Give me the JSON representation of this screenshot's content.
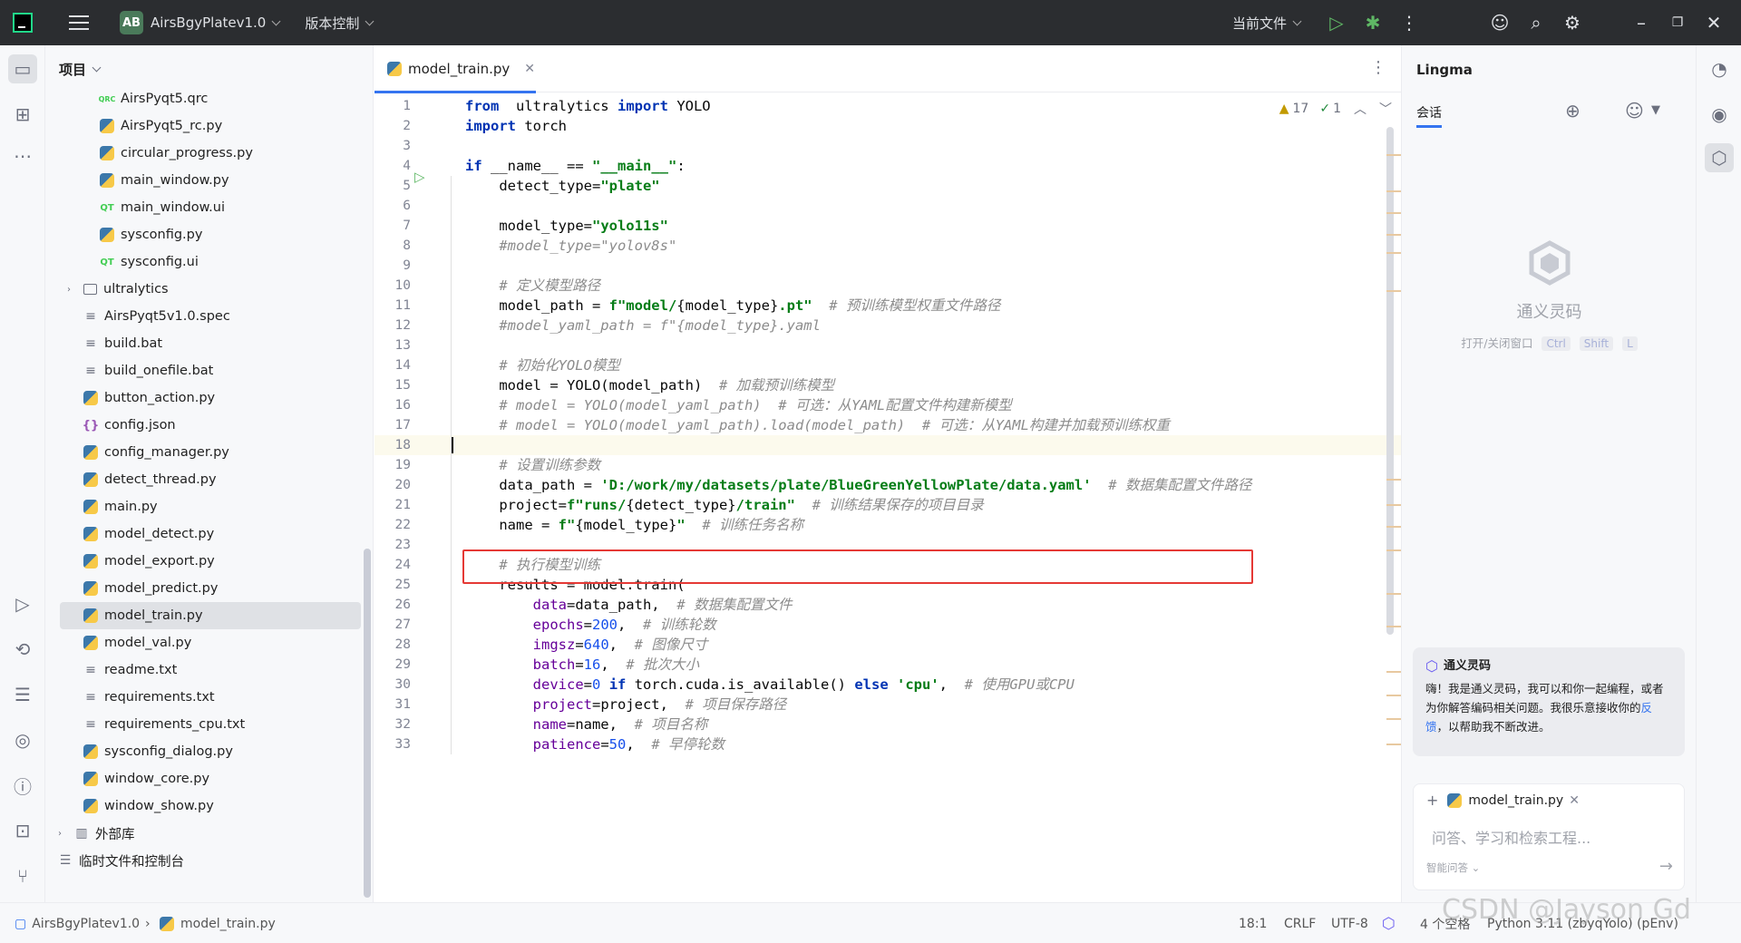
{
  "titlebar": {
    "project_badge": "AB",
    "project_name": "AirsBgyPlatev1.0",
    "vcs": "版本控制",
    "run_config": "当前文件"
  },
  "project_panel": {
    "title": "项目",
    "items": [
      {
        "name": "AirsPyqt5.qrc",
        "type": "qrc",
        "indent": 2
      },
      {
        "name": "AirsPyqt5_rc.py",
        "type": "py",
        "indent": 2
      },
      {
        "name": "circular_progress.py",
        "type": "py",
        "indent": 2
      },
      {
        "name": "main_window.py",
        "type": "py",
        "indent": 2
      },
      {
        "name": "main_window.ui",
        "type": "qt",
        "indent": 2
      },
      {
        "name": "sysconfig.py",
        "type": "py",
        "indent": 2
      },
      {
        "name": "sysconfig.ui",
        "type": "qt",
        "indent": 2
      },
      {
        "name": "ultralytics",
        "type": "folder",
        "indent": 1
      },
      {
        "name": "AirsPyqt5v1.0.spec",
        "type": "txt",
        "indent": 1
      },
      {
        "name": "build.bat",
        "type": "txt",
        "indent": 1
      },
      {
        "name": "build_onefile.bat",
        "type": "txt",
        "indent": 1
      },
      {
        "name": "button_action.py",
        "type": "py",
        "indent": 1
      },
      {
        "name": "config.json",
        "type": "json",
        "indent": 1
      },
      {
        "name": "config_manager.py",
        "type": "py",
        "indent": 1
      },
      {
        "name": "detect_thread.py",
        "type": "py",
        "indent": 1
      },
      {
        "name": "main.py",
        "type": "py",
        "indent": 1
      },
      {
        "name": "model_detect.py",
        "type": "py",
        "indent": 1
      },
      {
        "name": "model_export.py",
        "type": "py",
        "indent": 1
      },
      {
        "name": "model_predict.py",
        "type": "py",
        "indent": 1
      },
      {
        "name": "model_train.py",
        "type": "py",
        "indent": 1,
        "selected": true
      },
      {
        "name": "model_val.py",
        "type": "py",
        "indent": 1
      },
      {
        "name": "readme.txt",
        "type": "txt",
        "indent": 1
      },
      {
        "name": "requirements.txt",
        "type": "txt",
        "indent": 1
      },
      {
        "name": "requirements_cpu.txt",
        "type": "txt",
        "indent": 1
      },
      {
        "name": "sysconfig_dialog.py",
        "type": "py",
        "indent": 1
      },
      {
        "name": "window_core.py",
        "type": "py",
        "indent": 1
      },
      {
        "name": "window_show.py",
        "type": "py",
        "indent": 1
      },
      {
        "name": "外部库",
        "type": "lib",
        "indent": 0
      },
      {
        "name": "临时文件和控制台",
        "type": "scratch",
        "indent": 0
      }
    ]
  },
  "editor": {
    "tab_name": "model_train.py",
    "warnings": "17",
    "ok_count": "1",
    "current_line": 18,
    "highlight_line": 20
  },
  "code_lines": [
    [
      [
        "kw",
        "from"
      ],
      [
        "",
        "  ultralytics "
      ],
      [
        "kw",
        "import"
      ],
      [
        "",
        " YOLO"
      ]
    ],
    [
      [
        "kw",
        "import"
      ],
      [
        "",
        " torch"
      ]
    ],
    [],
    [
      [
        "kw",
        "if"
      ],
      [
        "",
        " __name__ == "
      ],
      [
        "str",
        "\"__main__\""
      ],
      [
        "",
        ":"
      ]
    ],
    [
      [
        "",
        "    detect_type="
      ],
      [
        "str",
        "\"plate\""
      ]
    ],
    [],
    [
      [
        "",
        "    model_type="
      ],
      [
        "str",
        "\"yolo11s\""
      ]
    ],
    [
      [
        "cm",
        "    #model_type=\"yolov8s\""
      ]
    ],
    [],
    [
      [
        "cm",
        "    # 定义模型路径"
      ]
    ],
    [
      [
        "",
        "    model_path = "
      ],
      [
        "str",
        "f\"model/"
      ],
      [
        "",
        "{model_type}"
      ],
      [
        "str",
        ".pt\""
      ],
      [
        "cm",
        "  # 预训练模型权重文件路径"
      ]
    ],
    [
      [
        "cm",
        "    #model_yaml_path = f\"{model_type}.yaml"
      ]
    ],
    [],
    [
      [
        "cm",
        "    # 初始化YOLO模型"
      ]
    ],
    [
      [
        "",
        "    model = YOLO(model_path)  "
      ],
      [
        "cm",
        "# 加载预训练模型"
      ]
    ],
    [
      [
        "cm",
        "    # model = YOLO(model_yaml_path)  # 可选：从YAML配置文件构建新模型"
      ]
    ],
    [
      [
        "cm",
        "    # model = YOLO(model_yaml_path).load(model_path)  # 可选：从YAML构建并加载预训练权重"
      ]
    ],
    [],
    [
      [
        "cm",
        "    # 设置训练参数"
      ]
    ],
    [
      [
        "",
        "    data_path = "
      ],
      [
        "str",
        "'D:/work/my/datasets/plate/BlueGreenYellowPlate/data.yaml'"
      ],
      [
        "cm",
        "  # 数据集配置文件路径"
      ]
    ],
    [
      [
        "",
        "    project="
      ],
      [
        "str",
        "f\"runs/"
      ],
      [
        "",
        "{detect_type}"
      ],
      [
        "str",
        "/train\""
      ],
      [
        "cm",
        "  # 训练结果保存的项目目录"
      ]
    ],
    [
      [
        "",
        "    name = "
      ],
      [
        "str",
        "f\""
      ],
      [
        "",
        "{model_type}"
      ],
      [
        "str",
        "\""
      ],
      [
        "cm",
        "  # 训练任务名称"
      ]
    ],
    [],
    [
      [
        "cm",
        "    # 执行模型训练"
      ]
    ],
    [
      [
        "",
        "    results = model.train("
      ]
    ],
    [
      [
        "kwarg",
        "        data"
      ],
      [
        "",
        "=data_path,  "
      ],
      [
        "cm",
        "# 数据集配置文件"
      ]
    ],
    [
      [
        "kwarg",
        "        epochs"
      ],
      [
        "",
        "="
      ],
      [
        "num",
        "200"
      ],
      [
        "",
        ",  "
      ],
      [
        "cm",
        "# 训练轮数"
      ]
    ],
    [
      [
        "kwarg",
        "        imgsz"
      ],
      [
        "",
        "="
      ],
      [
        "num",
        "640"
      ],
      [
        "",
        ",  "
      ],
      [
        "cm",
        "# 图像尺寸"
      ]
    ],
    [
      [
        "kwarg",
        "        batch"
      ],
      [
        "",
        "="
      ],
      [
        "num",
        "16"
      ],
      [
        "",
        ",  "
      ],
      [
        "cm",
        "# 批次大小"
      ]
    ],
    [
      [
        "kwarg",
        "        device"
      ],
      [
        "",
        "="
      ],
      [
        "num",
        "0"
      ],
      [
        "",
        " "
      ],
      [
        "kw",
        "if"
      ],
      [
        "",
        " torch.cuda.is_available() "
      ],
      [
        "kw",
        "else"
      ],
      [
        "",
        " "
      ],
      [
        "str",
        "'cpu'"
      ],
      [
        "",
        ",  "
      ],
      [
        "cm",
        "# 使用GPU或CPU"
      ]
    ],
    [
      [
        "kwarg",
        "        project"
      ],
      [
        "",
        "=project,  "
      ],
      [
        "cm",
        "# 项目保存路径"
      ]
    ],
    [
      [
        "kwarg",
        "        name"
      ],
      [
        "",
        "=name,  "
      ],
      [
        "cm",
        "# 项目名称"
      ]
    ],
    [
      [
        "kwarg",
        "        patience"
      ],
      [
        "",
        "="
      ],
      [
        "num",
        "50"
      ],
      [
        "",
        ",  "
      ],
      [
        "cm",
        "# 早停轮数"
      ]
    ]
  ],
  "lingma": {
    "title": "Lingma",
    "tab": "会话",
    "brand": "通义灵码",
    "shortcut_label": "打开/关闭窗口",
    "keys": [
      "Ctrl",
      "Shift",
      "L"
    ],
    "card_title": "通义灵码",
    "card_text_1": "嗨！我是通义灵码，我可以和你一起编程，或者为你解答编码相关问题。我很乐意接收你的",
    "card_link": "反馈",
    "card_text_2": "，以帮助我不断改进。",
    "context_file": "model_train.py",
    "input_placeholder": "问答、学习和检索工程...",
    "mode": "智能问答"
  },
  "statusbar": {
    "project": "AirsBgyPlatev1.0",
    "file": "model_train.py",
    "position": "18:1",
    "line_sep": "CRLF",
    "encoding": "UTF-8",
    "indent": "4 个空格",
    "interpreter": "Python 3.11 (zbyqYolo) (pEnv)"
  },
  "watermark": "CSDN @Jayson Gd"
}
